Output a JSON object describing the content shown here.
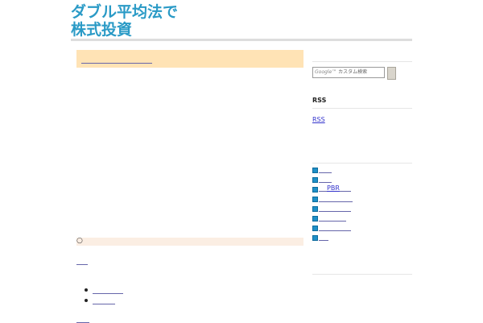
{
  "header": {
    "title_line1": "ダブル平均法で",
    "title_line2": "株式投資"
  },
  "main": {
    "comment_mark": "○"
  },
  "sidebar": {
    "search": {
      "placeholder_brand": "Google™",
      "placeholder_text": "カスタム検索"
    },
    "rss": {
      "heading": "RSS",
      "link_label": "RSS"
    },
    "categories": [
      {
        "label": ""
      },
      {
        "label": ""
      },
      {
        "label": "PBR"
      },
      {
        "label": ""
      },
      {
        "label": ""
      },
      {
        "label": ""
      },
      {
        "label": ""
      },
      {
        "label": ""
      }
    ]
  },
  "colors": {
    "title": "#2a9ac6",
    "post_band": "#ffe3b5",
    "comment_band": "#fbeee3",
    "link": "#3333cc",
    "category_icon": "#1e8fc7"
  }
}
